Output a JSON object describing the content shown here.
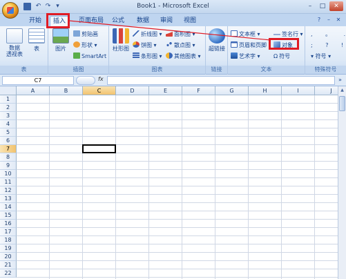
{
  "window": {
    "title": "Book1 - Microsoft Excel"
  },
  "quick_access": {
    "undo_glyph": "↶",
    "redo_glyph": "↷",
    "dropdown_glyph": "▾"
  },
  "window_controls": {
    "minimize": "–",
    "maximize": "□",
    "close": "✕"
  },
  "tabs": [
    {
      "label": "开始"
    },
    {
      "label": "插入",
      "active": true
    },
    {
      "label": "页面布局"
    },
    {
      "label": "公式"
    },
    {
      "label": "数据"
    },
    {
      "label": "审阅"
    },
    {
      "label": "视图"
    }
  ],
  "help": {
    "label": "?"
  },
  "ribbon": {
    "groups": {
      "tables": {
        "label": "表",
        "pivot_label": "数据\n透视表",
        "table_label": "表"
      },
      "illustrations": {
        "label": "插图",
        "picture_label": "图片",
        "clipart_label": "剪贴画",
        "shapes_label": "形状",
        "smartart_label": "SmartArt"
      },
      "charts": {
        "label": "图表",
        "column_label": "柱形图",
        "line_label": "折线图",
        "pie_label": "饼图",
        "bar_label": "条形图",
        "area_label": "面积图",
        "scatter_label": "散点图",
        "other_label": "其他图表"
      },
      "links": {
        "label": "链接",
        "hyperlink_label": "超链接"
      },
      "text": {
        "label": "文本",
        "textbox_label": "文本框",
        "header_footer_label": "页眉和页脚",
        "wordart_label": "艺术字",
        "signature_label": "签名行",
        "object_label": "对象",
        "symbol_label": "符号"
      },
      "special_symbols": {
        "label": "特殊符号",
        "symbol_label": "符号"
      }
    }
  },
  "formula_bar": {
    "name_box": "C7",
    "fx": "fx"
  },
  "sheet": {
    "columns": [
      "A",
      "B",
      "C",
      "D",
      "E",
      "F",
      "G",
      "H",
      "I",
      "J"
    ],
    "rows": [
      "1",
      "2",
      "3",
      "4",
      "5",
      "6",
      "7",
      "8",
      "9",
      "10",
      "11",
      "12",
      "13",
      "14",
      "15",
      "16",
      "17",
      "18",
      "19",
      "20",
      "21",
      "22"
    ],
    "active_cell": "C7"
  },
  "colors": {
    "accent": "#15428b",
    "ribbon_bg": "#dde9f7",
    "highlight": "#e01b24",
    "selected_header": "#f2c36f"
  }
}
